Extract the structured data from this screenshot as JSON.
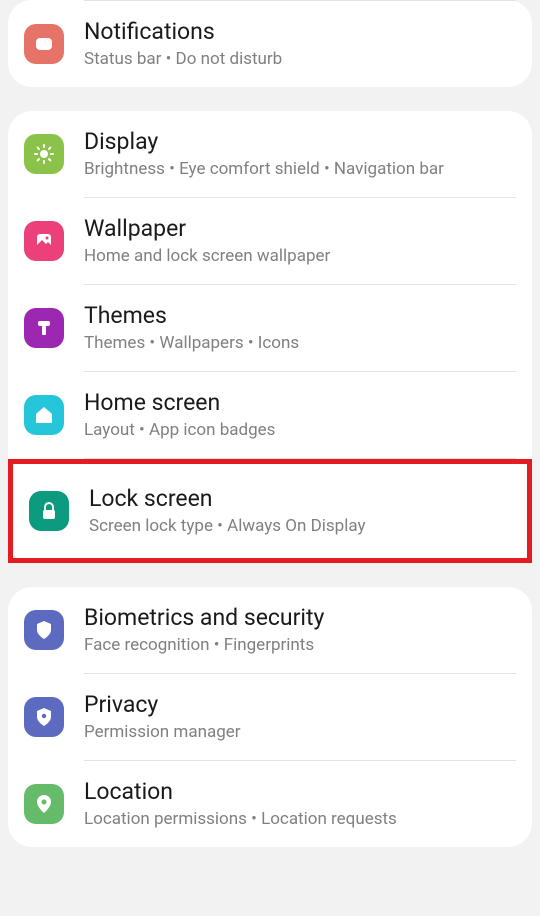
{
  "groups": [
    {
      "items": [
        {
          "key": "notifications",
          "title": "Notifications",
          "subtitle": "Status bar  •  Do not disturb",
          "icon": "notif"
        }
      ]
    },
    {
      "items": [
        {
          "key": "display",
          "title": "Display",
          "subtitle": "Brightness  •  Eye comfort shield  •  Navigation bar",
          "icon": "display"
        },
        {
          "key": "wallpaper",
          "title": "Wallpaper",
          "subtitle": "Home and lock screen wallpaper",
          "icon": "wallpaper"
        },
        {
          "key": "themes",
          "title": "Themes",
          "subtitle": "Themes  •  Wallpapers  •  Icons",
          "icon": "themes"
        },
        {
          "key": "homescreen",
          "title": "Home screen",
          "subtitle": "Layout  •  App icon badges",
          "icon": "home"
        },
        {
          "key": "lockscreen",
          "title": "Lock screen",
          "subtitle": "Screen lock type  •  Always On Display",
          "icon": "lock",
          "highlighted": true
        }
      ]
    },
    {
      "items": [
        {
          "key": "biometrics",
          "title": "Biometrics and security",
          "subtitle": "Face recognition  •  Fingerprints",
          "icon": "bio"
        },
        {
          "key": "privacy",
          "title": "Privacy",
          "subtitle": "Permission manager",
          "icon": "privacy"
        },
        {
          "key": "location",
          "title": "Location",
          "subtitle": "Location permissions  •  Location requests",
          "icon": "location"
        }
      ]
    }
  ]
}
